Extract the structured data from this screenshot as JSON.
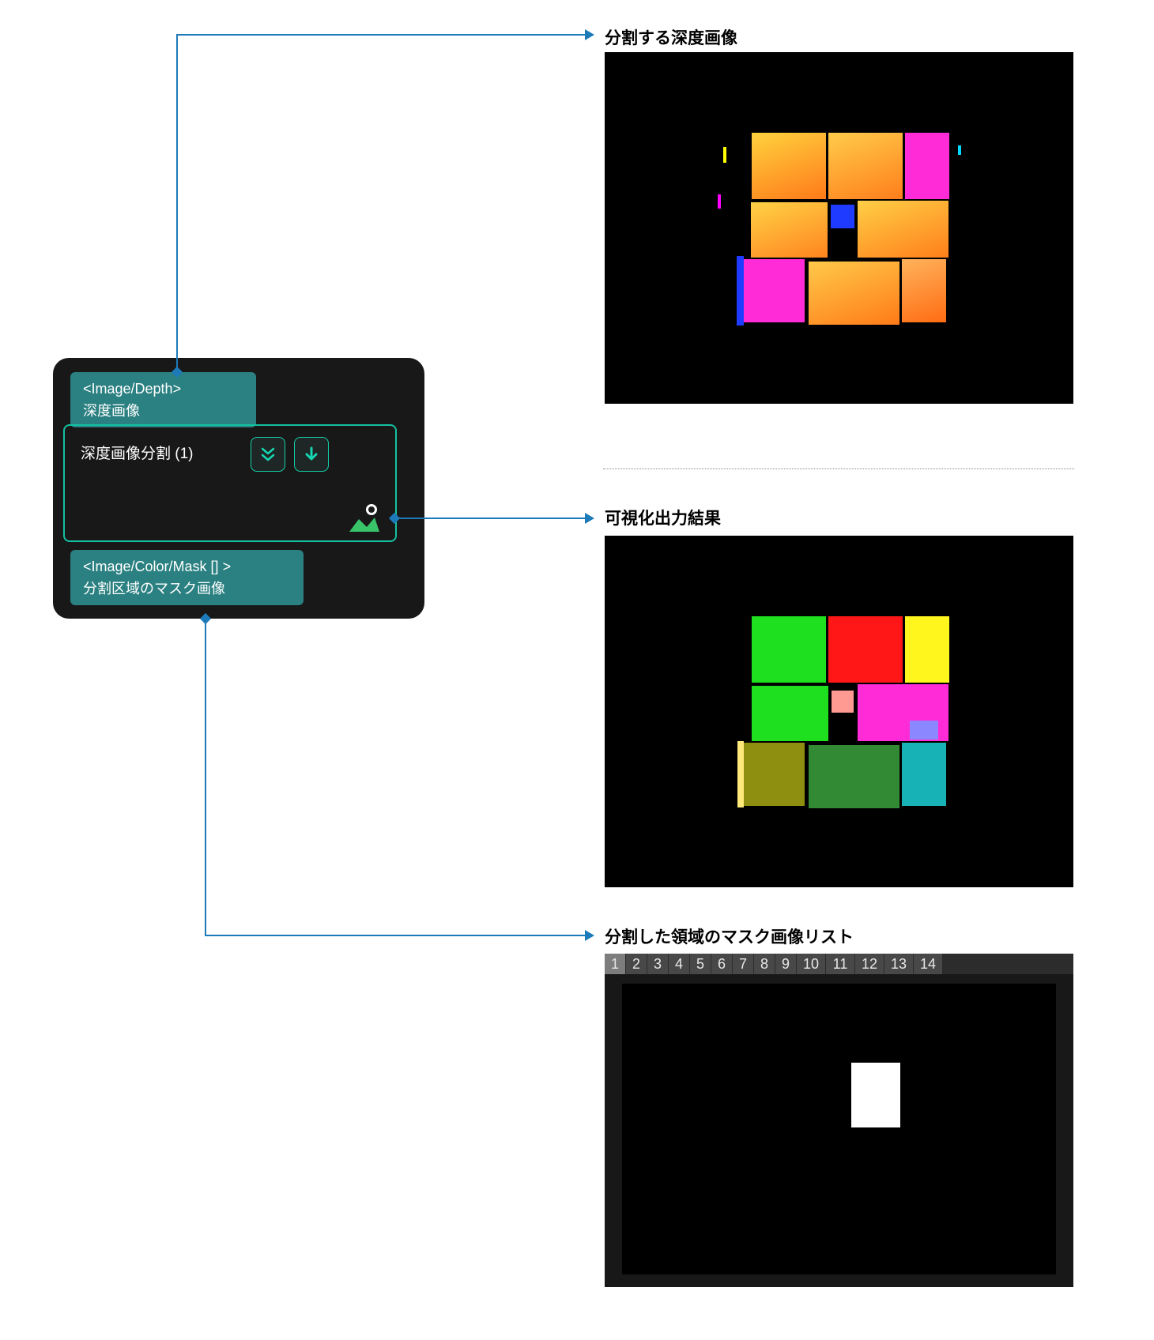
{
  "headings": {
    "depth_input": "分割する深度画像",
    "viz_output": "可視化出力結果",
    "mask_list": "分割した領域のマスク画像リスト"
  },
  "node": {
    "input_tag_type": "<Image/Depth>",
    "input_tag_label": "深度画像",
    "title": "深度画像分割 (1)",
    "output_tag_type": "<Image/Color/Mask [] >",
    "output_tag_label": "分割区域のマスク画像"
  },
  "mask_tabs": [
    "1",
    "2",
    "3",
    "4",
    "5",
    "6",
    "7",
    "8",
    "9",
    "10",
    "11",
    "12",
    "13",
    "14"
  ],
  "icons": {
    "chevrons_down": "chevrons-down-icon",
    "arrow_down": "arrow-down-icon",
    "eye_image": "visualize-icon"
  },
  "colors": {
    "connector": "#1d7ab8",
    "node_bg": "#181819",
    "tag_bg": "#2b8081",
    "accent": "#14c2a1"
  }
}
